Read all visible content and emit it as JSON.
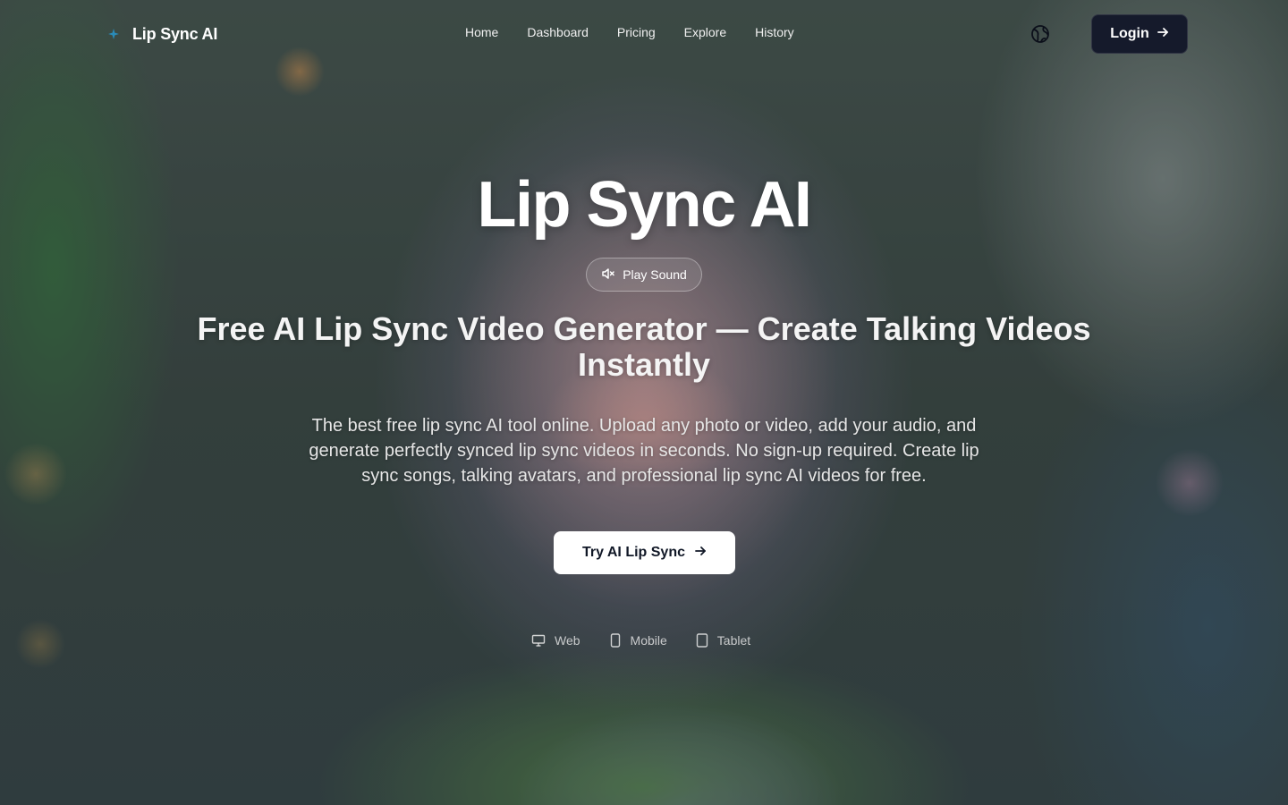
{
  "brand": {
    "name": "Lip Sync AI",
    "icon": "sparkle-icon",
    "accent": "#2a8bb8"
  },
  "nav": {
    "items": [
      {
        "label": "Home"
      },
      {
        "label": "Dashboard"
      },
      {
        "label": "Pricing"
      },
      {
        "label": "Explore"
      },
      {
        "label": "History"
      }
    ]
  },
  "header": {
    "language_icon": "globe-icon",
    "login_label": "Login",
    "login_bg": "#151a2b"
  },
  "hero": {
    "title": "Lip Sync AI",
    "play_sound_label": "Play Sound",
    "subtitle": "Free AI Lip Sync Video Generator — Create Talking Videos Instantly",
    "description": "The best free lip sync AI tool online. Upload any photo or video, add your audio, and generate perfectly synced lip sync videos in seconds. No sign-up required. Create lip sync songs, talking avatars, and professional lip sync AI videos for free.",
    "cta_label": "Try AI Lip Sync",
    "devices": [
      {
        "label": "Web",
        "icon": "monitor-icon"
      },
      {
        "label": "Mobile",
        "icon": "smartphone-icon"
      },
      {
        "label": "Tablet",
        "icon": "tablet-icon"
      }
    ]
  }
}
